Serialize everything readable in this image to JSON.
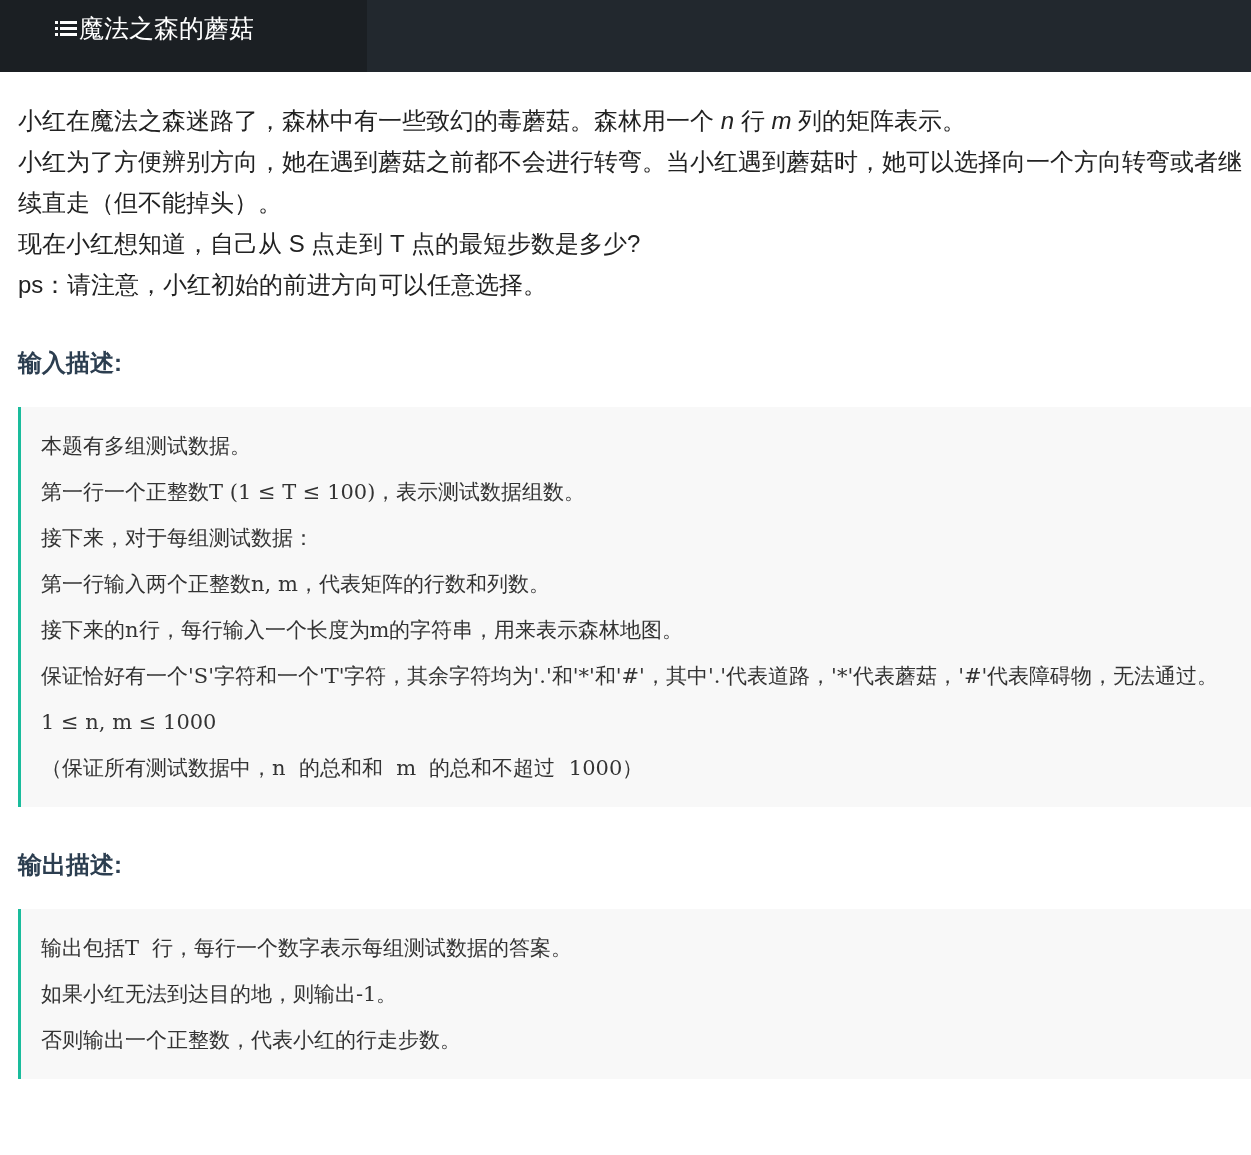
{
  "header": {
    "title": "魔法之森的蘑菇"
  },
  "intro": [
    "小红在魔法之森迷路了，森林中有一些致幻的毒蘑菇。森林用一个 *n* 行 *m* 列的矩阵表示。",
    "小红为了方便辨别方向，她在遇到蘑菇之前都不会进行转弯。当小红遇到蘑菇时，她可以选择向一个方向转弯或者继续直走（但不能掉头）。",
    "现在小红想知道，自己从 S 点走到 T 点的最短步数是多少?",
    "ps：请注意，小红初始的前进方向可以任意选择。"
  ],
  "sections": [
    {
      "heading": "输入描述:",
      "lines": [
        "本题有多组测试数据。",
        "第一行一个正整数T (1 ≤ T ≤ 100)，表示测试数据组数。",
        "接下来，对于每组测试数据：",
        "第一行输入两个正整数n, m，代表矩阵的行数和列数。",
        "接下来的n行，每行输入一个长度为m的字符串，用来表示森林地图。",
        "保证恰好有一个'S'字符和一个'T'字符，其余字符均为'.'和'*'和'#'，其中'.'代表道路，'*'代表蘑菇，'#'代表障碍物，无法通过。",
        "1 ≤ n, m ≤ 1000",
        "（保证所有测试数据中，n  的总和和  m  的总和不超过  1000）"
      ]
    },
    {
      "heading": "输出描述:",
      "lines": [
        "输出包括T  行，每行一个数字表示每组测试数据的答案。",
        "如果小红无法到达目的地，则输出-1。",
        "否则输出一个正整数，代表小红的行走步数。"
      ]
    }
  ]
}
